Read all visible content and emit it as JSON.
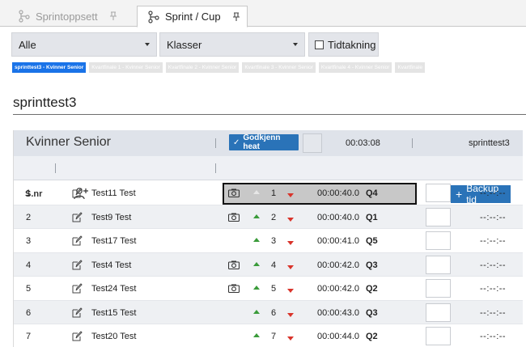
{
  "tabs": [
    {
      "label": "Sprintoppsett",
      "active": false
    },
    {
      "label": "Sprint / Cup",
      "active": true
    }
  ],
  "filters": {
    "select1": "Alle",
    "select2": "Klasser",
    "checkbox_label": "Tidtakning",
    "checkbox_checked": false
  },
  "heat_chips": [
    {
      "label": "sprinttest3 - Kvinner Senior",
      "active": true
    },
    {
      "label": "Kvartfinale 1 - Kvinner Senior",
      "active": false
    },
    {
      "label": "Kvartfinale 2 - Kvinner Senior",
      "active": false
    },
    {
      "label": "Kvartfinale 3 - Kvinner Senior",
      "active": false
    },
    {
      "label": "Kvartfinale 4 - Kvinner Senior",
      "active": false
    },
    {
      "label": "Kvartfinale",
      "active": false
    }
  ],
  "heading": "sprinttest3",
  "grid": {
    "class_title": "Kvinner Senior",
    "approve_label": "Godkjenn heat",
    "elapsed": "00:03:08",
    "heat_name": "sprinttest3",
    "col_snr": "S.nr",
    "backup_label": "Backup tid"
  },
  "rows": [
    {
      "nr": "1",
      "name": "Test11 Test",
      "camera": true,
      "up": false,
      "pos": "1",
      "time": "00:00:40.0",
      "q": "Q4",
      "backup": "--:--:--"
    },
    {
      "nr": "2",
      "name": "Test9 Test",
      "camera": true,
      "up": true,
      "pos": "2",
      "time": "00:00:40.0",
      "q": "Q1",
      "backup": "--:--:--"
    },
    {
      "nr": "3",
      "name": "Test17 Test",
      "camera": false,
      "up": true,
      "pos": "3",
      "time": "00:00:41.0",
      "q": "Q5",
      "backup": "--:--:--"
    },
    {
      "nr": "4",
      "name": "Test4 Test",
      "camera": true,
      "up": true,
      "pos": "4",
      "time": "00:00:42.0",
      "q": "Q3",
      "backup": "--:--:--"
    },
    {
      "nr": "5",
      "name": "Test24 Test",
      "camera": true,
      "up": true,
      "pos": "5",
      "time": "00:00:42.0",
      "q": "Q2",
      "backup": "--:--:--"
    },
    {
      "nr": "6",
      "name": "Test15 Test",
      "camera": false,
      "up": true,
      "pos": "6",
      "time": "00:00:43.0",
      "q": "Q3",
      "backup": "--:--:--"
    },
    {
      "nr": "7",
      "name": "Test20 Test",
      "camera": false,
      "up": true,
      "pos": "7",
      "time": "00:00:44.0",
      "q": "Q2",
      "backup": "--:--:--"
    }
  ],
  "colors": {
    "accent": "#2a73b8",
    "chip_active": "#1a73e8",
    "arrow_up": "#3a9b3a",
    "arrow_down": "#d9342b"
  }
}
